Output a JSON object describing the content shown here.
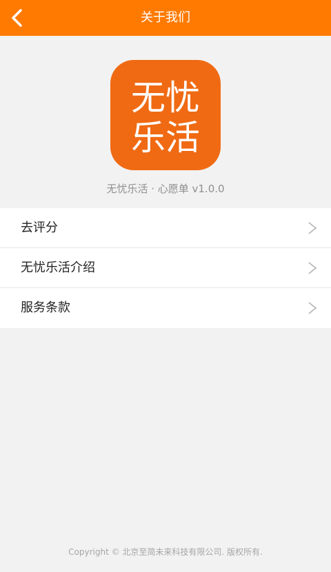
{
  "navbar": {
    "title": "关于我们",
    "background": "#ff7a00",
    "back_icon": "chevron-left-icon"
  },
  "app": {
    "logo_text_line1": "无忧",
    "logo_text_line2": "乐活",
    "logo_color": "#f06a13",
    "version_text": "无忧乐活 · 心愿单 v1.0.0"
  },
  "menu": {
    "items": [
      {
        "label": "去评分",
        "icon": "chevron-right-icon"
      },
      {
        "label": "无忧乐活介绍",
        "icon": "chevron-right-icon"
      },
      {
        "label": "服务条款",
        "icon": "chevron-right-icon"
      }
    ]
  },
  "footer": {
    "copyright": "Copyright © 北京至简未来科技有限公司. 版权所有."
  }
}
